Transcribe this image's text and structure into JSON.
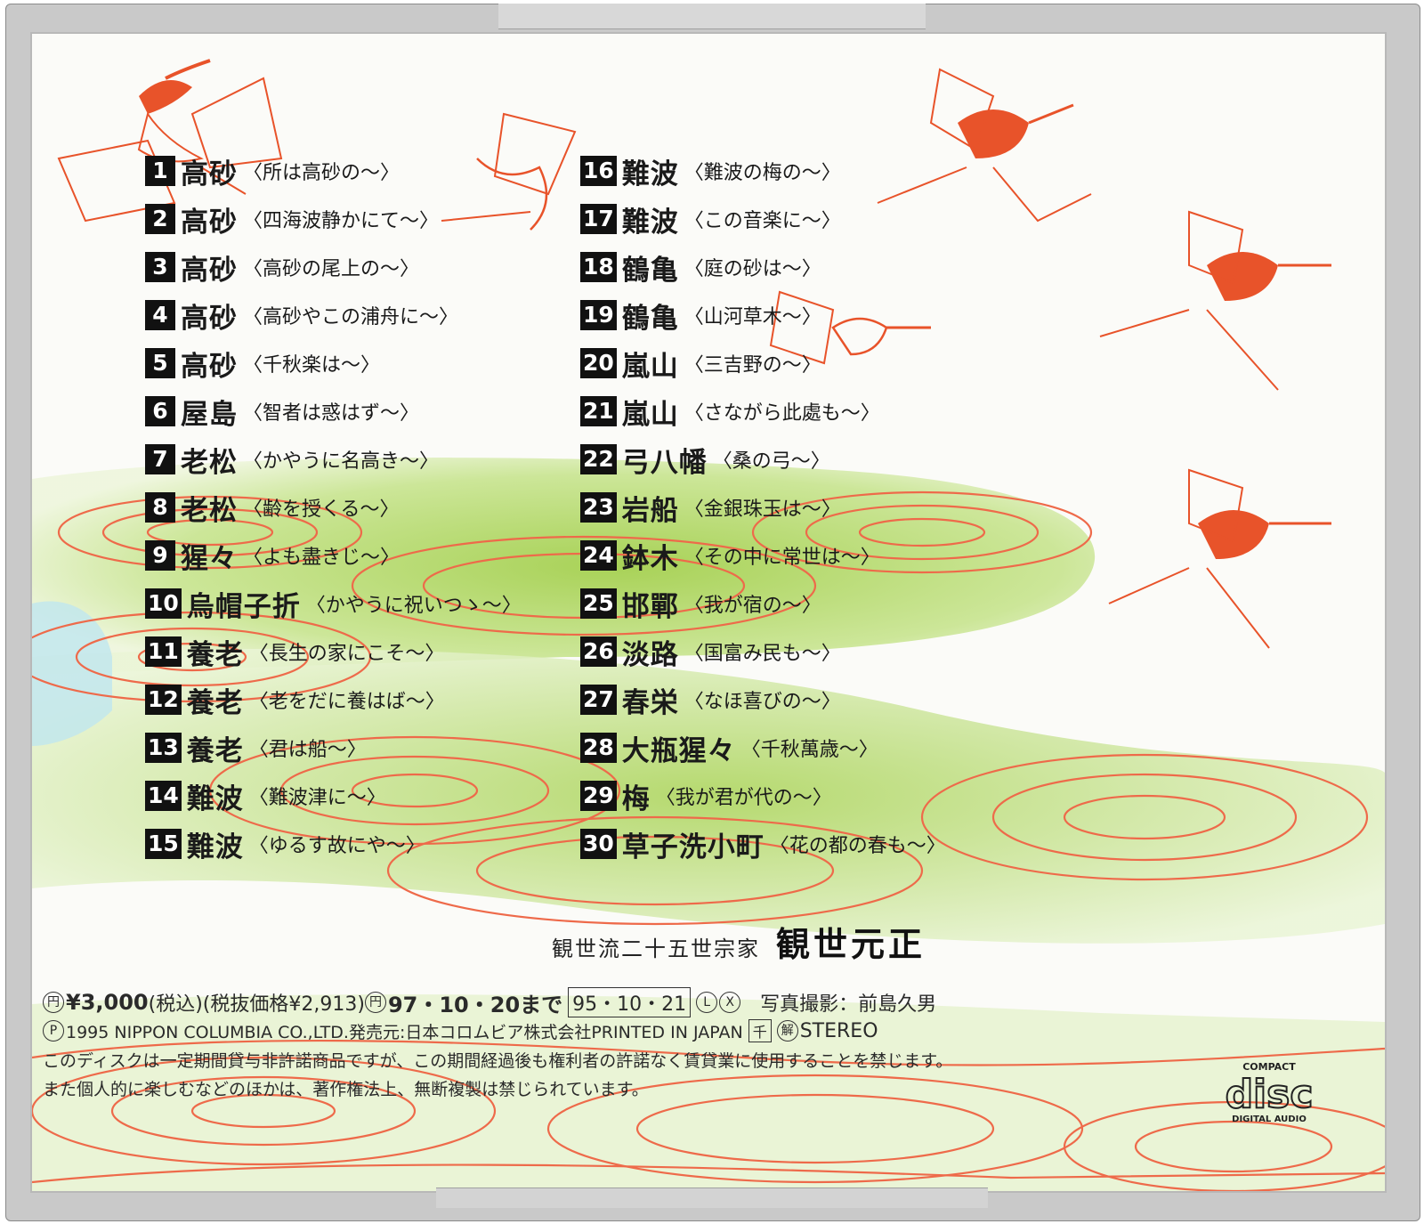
{
  "tracks_left": [
    {
      "num": "1",
      "title": "高砂",
      "lyric": "〈所は高砂の～〉"
    },
    {
      "num": "2",
      "title": "高砂",
      "lyric": "〈四海波静かにて～〉"
    },
    {
      "num": "3",
      "title": "高砂",
      "lyric": "〈高砂の尾上の～〉"
    },
    {
      "num": "4",
      "title": "高砂",
      "lyric": "〈高砂やこの浦舟に～〉"
    },
    {
      "num": "5",
      "title": "高砂",
      "lyric": "〈千秋楽は～〉"
    },
    {
      "num": "6",
      "title": "屋島",
      "lyric": "〈智者は惑はず～〉"
    },
    {
      "num": "7",
      "title": "老松",
      "lyric": "〈かやうに名高き～〉"
    },
    {
      "num": "8",
      "title": "老松",
      "lyric": "〈齢を授くる～〉"
    },
    {
      "num": "9",
      "title": "猩々",
      "lyric": "〈よも盡きじ～〉"
    },
    {
      "num": "10",
      "title": "烏帽子折",
      "lyric": "〈かやうに祝いつゝ～〉"
    },
    {
      "num": "11",
      "title": "養老",
      "lyric": "〈長生の家にこそ～〉"
    },
    {
      "num": "12",
      "title": "養老",
      "lyric": "〈老をだに養はば～〉"
    },
    {
      "num": "13",
      "title": "養老",
      "lyric": "〈君は船～〉"
    },
    {
      "num": "14",
      "title": "難波",
      "lyric": "〈難波津に～〉"
    },
    {
      "num": "15",
      "title": "難波",
      "lyric": "〈ゆるす故にや～〉"
    }
  ],
  "tracks_right": [
    {
      "num": "16",
      "title": "難波",
      "lyric": "〈難波の梅の～〉"
    },
    {
      "num": "17",
      "title": "難波",
      "lyric": "〈この音楽に～〉"
    },
    {
      "num": "18",
      "title": "鶴亀",
      "lyric": "〈庭の砂は～〉"
    },
    {
      "num": "19",
      "title": "鶴亀",
      "lyric": "〈山河草木～〉"
    },
    {
      "num": "20",
      "title": "嵐山",
      "lyric": "〈三吉野の～〉"
    },
    {
      "num": "21",
      "title": "嵐山",
      "lyric": "〈さながら此處も～〉"
    },
    {
      "num": "22",
      "title": "弓八幡",
      "lyric": "〈桑の弓～〉"
    },
    {
      "num": "23",
      "title": "岩船",
      "lyric": "〈金銀珠玉は～〉"
    },
    {
      "num": "24",
      "title": "鉢木",
      "lyric": "〈その中に常世は～〉"
    },
    {
      "num": "25",
      "title": "邯鄲",
      "lyric": "〈我が宿の～〉"
    },
    {
      "num": "26",
      "title": "淡路",
      "lyric": "〈国富み民も～〉"
    },
    {
      "num": "27",
      "title": "春栄",
      "lyric": "〈なほ喜びの～〉"
    },
    {
      "num": "28",
      "title": "大瓶猩々",
      "lyric": "〈千秋萬歳～〉"
    },
    {
      "num": "29",
      "title": "梅",
      "lyric": "〈我が君が代の～〉"
    },
    {
      "num": "30",
      "title": "草子洗小町",
      "lyric": "〈花の都の春も～〉"
    }
  ],
  "performer": {
    "school": "観世流二十五世宗家",
    "name": "観世元正"
  },
  "credits": {
    "price_mark": "円",
    "price": "¥3,000",
    "tax_in": "(税込)",
    "tax_ex": "(税抜価格¥2,913)",
    "until_mark": "円",
    "until": "97・10・20まで",
    "release_date": "95・10・21",
    "mark_l": "L",
    "mark_x": "X",
    "photo": "写真撮影：前島久男",
    "copyright_mark": "P",
    "copyright": "1995 NIPPON COLUMBIA CO.,LTD.発売元:日本コロムビア株式会社PRINTED IN JAPAN",
    "mark_sen": "千",
    "mark_kai": "解",
    "stereo": "STEREO",
    "notice1": "このディスクは一定期間貸与非許諾商品ですが、この期間経過後も権利者の許諾なく賃貸業に使用することを禁じます。",
    "notice2": "また個人的に楽しむなどのほかは、著作権法上、無断複製は禁じられています。"
  },
  "cd_logo": {
    "compact": "COMPACT",
    "disc": "disc",
    "digital": "DIGITAL AUDIO"
  },
  "colors": {
    "bird_red": "#e8532a",
    "wave_green": "#a8d25a",
    "wave_red": "#ee6a4a",
    "case_grey": "#c9c9c9"
  }
}
